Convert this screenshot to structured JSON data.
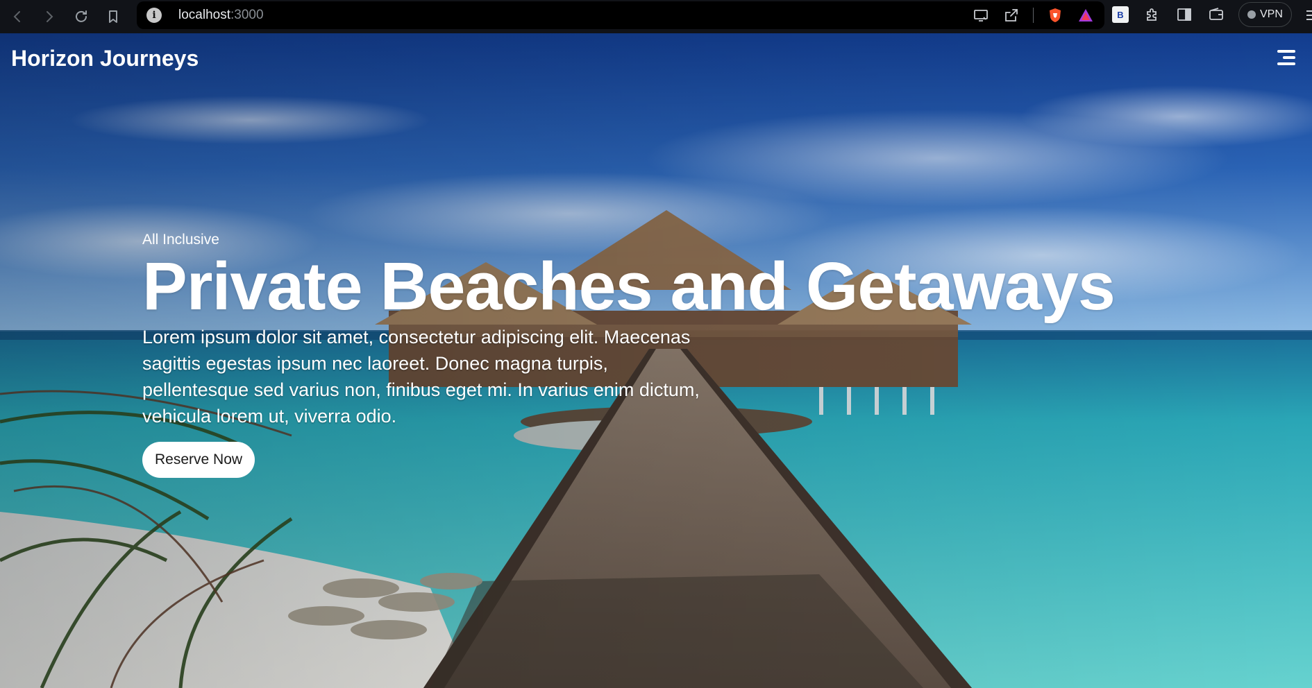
{
  "browser": {
    "url_host": "localhost",
    "url_port": ":3000",
    "vpn_label": "VPN",
    "extension_badge": "B"
  },
  "icons": {
    "back": "back-arrow-icon",
    "forward": "forward-arrow-icon",
    "reload": "reload-icon",
    "bookmark": "bookmark-icon",
    "site_info": "info-icon",
    "cast": "cast-icon",
    "share": "share-icon",
    "brave_shield": "brave-shield-icon",
    "brave_rewards": "rewards-triangle-icon",
    "extensions": "puzzle-icon",
    "sidebar": "sidebar-icon",
    "wallet": "wallet-icon",
    "menu": "hamburger-menu-icon"
  },
  "site": {
    "logo": "Horizon Journeys"
  },
  "hero": {
    "eyebrow": "All Inclusive",
    "title": "Private Beaches and Getaways",
    "description": "Lorem ipsum dolor sit amet, consectetur adipiscing elit. Maecenas sagittis egestas ipsum nec laoreet. Donec magna turpis, pellentesque sed varius non, finibus eget mi. In varius enim dictum, vehicula lorem ut, viverra odio.",
    "cta_label": "Reserve Now"
  },
  "colors": {
    "sky_top": "#1e4fa6",
    "sky_bottom": "#7fb0e0",
    "sea": "#2fb1bd",
    "cta_bg": "#ffffff"
  }
}
